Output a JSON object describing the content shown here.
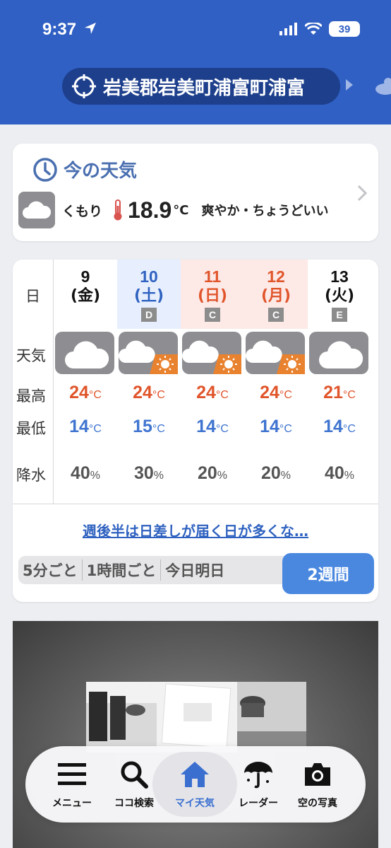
{
  "status_bar": {
    "time": "9:37",
    "battery": "39"
  },
  "header": {
    "location": "岩美郡岩美町浦富町浦富"
  },
  "now": {
    "title": "今の天気",
    "condition": "くもり",
    "temperature": "18.9",
    "unit": "°C",
    "feeling": "爽やか・ちょうどいい"
  },
  "forecast": {
    "row_labels": {
      "day": "日",
      "weather": "天気",
      "high": "最高",
      "low": "最低",
      "precip": "降水"
    },
    "days": [
      {
        "day": "9",
        "dow": "(金)",
        "tag": "",
        "weather": "cloudy",
        "high": "24",
        "low": "14",
        "precip": "40",
        "color": "#111111",
        "bg": "#ffffff"
      },
      {
        "day": "10",
        "dow": "(土)",
        "tag": "D",
        "weather": "cloudy-sun",
        "high": "24",
        "low": "15",
        "precip": "30",
        "color": "#2f62c0",
        "bg": "#e7efff"
      },
      {
        "day": "11",
        "dow": "(日)",
        "tag": "C",
        "weather": "cloudy-sun",
        "high": "24",
        "low": "14",
        "precip": "20",
        "color": "#e0552b",
        "bg": "#fde9e6"
      },
      {
        "day": "12",
        "dow": "(月)",
        "tag": "C",
        "weather": "cloudy-sun",
        "high": "24",
        "low": "14",
        "precip": "20",
        "color": "#e0552b",
        "bg": "#fde9e6"
      },
      {
        "day": "13",
        "dow": "(火)",
        "tag": "E",
        "weather": "cloudy",
        "high": "21",
        "low": "14",
        "precip": "40",
        "color": "#111111",
        "bg": "#ffffff"
      }
    ],
    "temp_unit": "°C",
    "precip_unit": "%",
    "summary_link": "週後半は日差しが届く日が多くな…",
    "tabs": [
      "5分ごと",
      "1時間ごと",
      "今日明日"
    ],
    "active_tab": "2週間"
  },
  "nav": {
    "items": [
      {
        "label": "メニュー",
        "icon": "menu-icon"
      },
      {
        "label": "ココ検索",
        "icon": "search-icon"
      },
      {
        "label": "マイ天気",
        "icon": "home-icon"
      },
      {
        "label": "レーダー",
        "icon": "umbrella-icon"
      },
      {
        "label": "空の写真",
        "icon": "camera-icon"
      }
    ],
    "active_index": 2
  },
  "colors": {
    "header": "#3060c4",
    "accent": "#4a88e0",
    "high": "#e0552b",
    "low": "#3f74d0"
  }
}
